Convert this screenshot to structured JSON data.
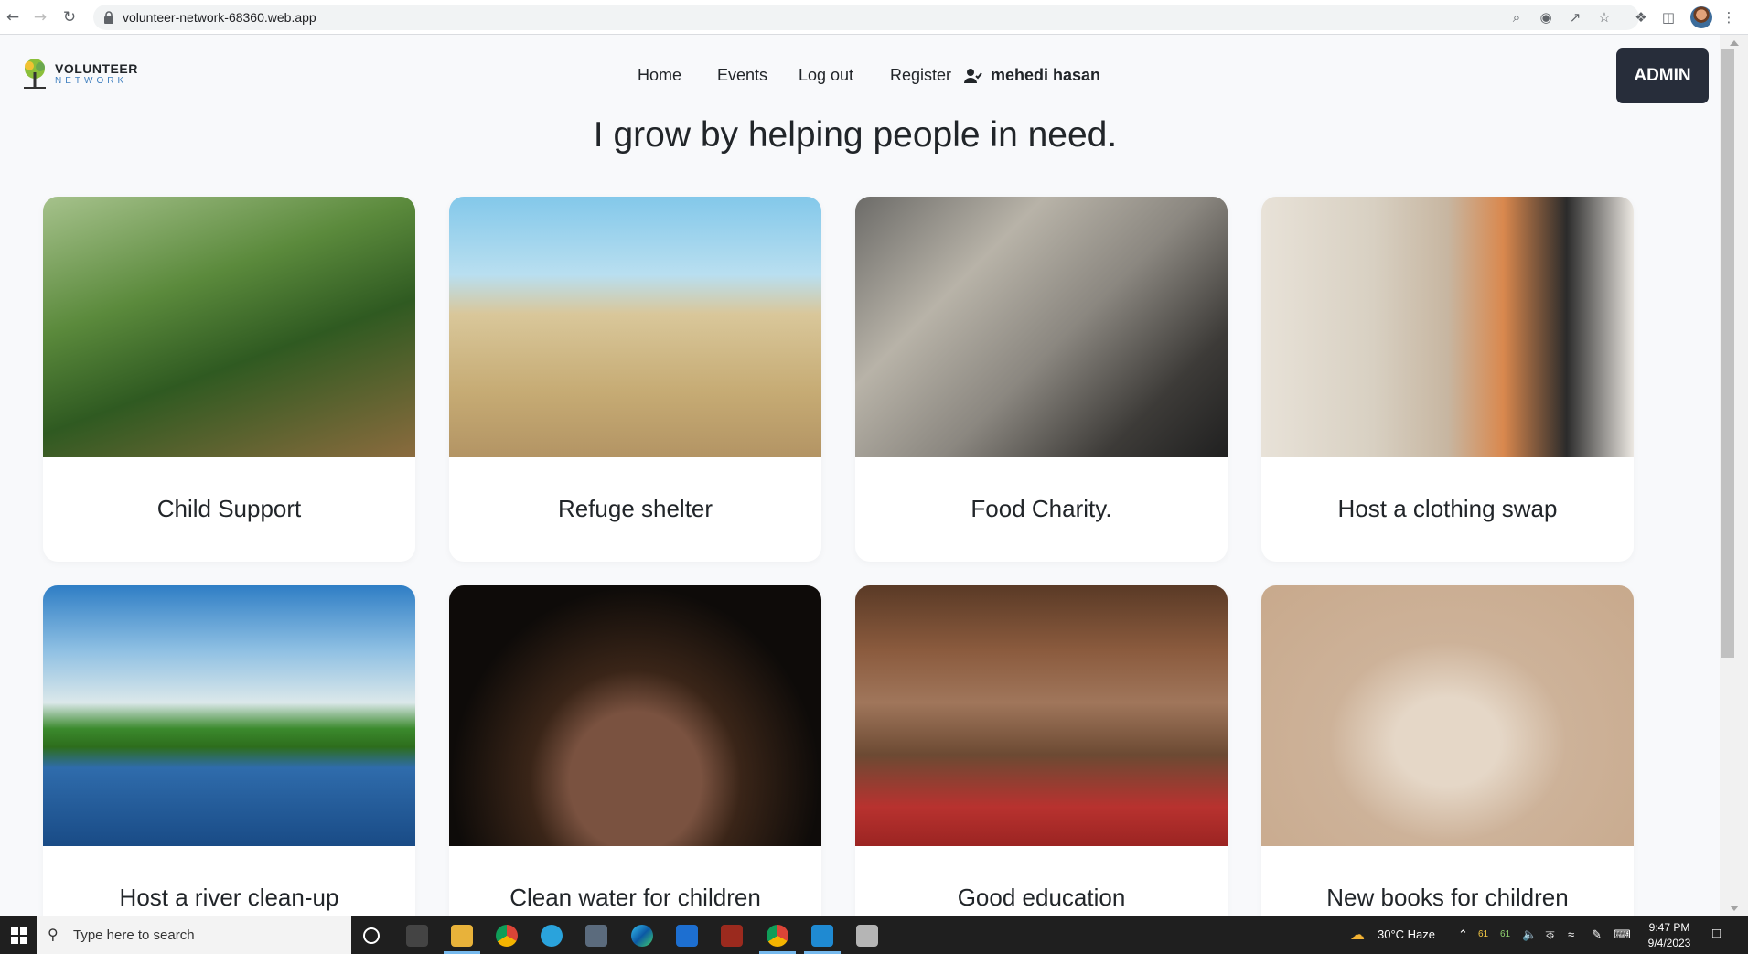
{
  "browser": {
    "url": "volunteer-network-68360.web.app",
    "back_icon": "back-arrow-icon",
    "forward_icon": "forward-arrow-icon",
    "reload_icon": "reload-icon"
  },
  "header": {
    "logo_line1": "VOLUNTEER",
    "logo_line2": "NETWORK",
    "nav": [
      "Home",
      "Events",
      "Log out",
      "Register"
    ],
    "user_name": "mehedi hasan",
    "admin_label": "ADMIN"
  },
  "tagline": "I grow by helping people in need.",
  "cards": [
    {
      "title": "Child Support",
      "image": "girl-outdoors-photo"
    },
    {
      "title": "Refuge shelter",
      "image": "boy-in-field-photo"
    },
    {
      "title": "Food Charity.",
      "image": "food-distribution-photo"
    },
    {
      "title": "Host a clothing swap",
      "image": "clothing-rack-photo"
    },
    {
      "title": "Host a river clean-up",
      "image": "river-landscape-photo"
    },
    {
      "title": "Clean water for children",
      "image": "water-in-hands-photo"
    },
    {
      "title": "Good education",
      "image": "boy-reading-library-photo"
    },
    {
      "title": "New books for children",
      "image": "open-book-photo"
    }
  ],
  "taskbar": {
    "search_placeholder": "Type here to search",
    "weather": "30°C  Haze",
    "tray_numbers": [
      "61",
      "61"
    ],
    "time": "9:47 PM",
    "date": "9/4/2023"
  },
  "colors": {
    "admin_bg": "#272d3a",
    "page_bg": "#f8f9fb",
    "logo_accent": "#3f7fbf"
  }
}
